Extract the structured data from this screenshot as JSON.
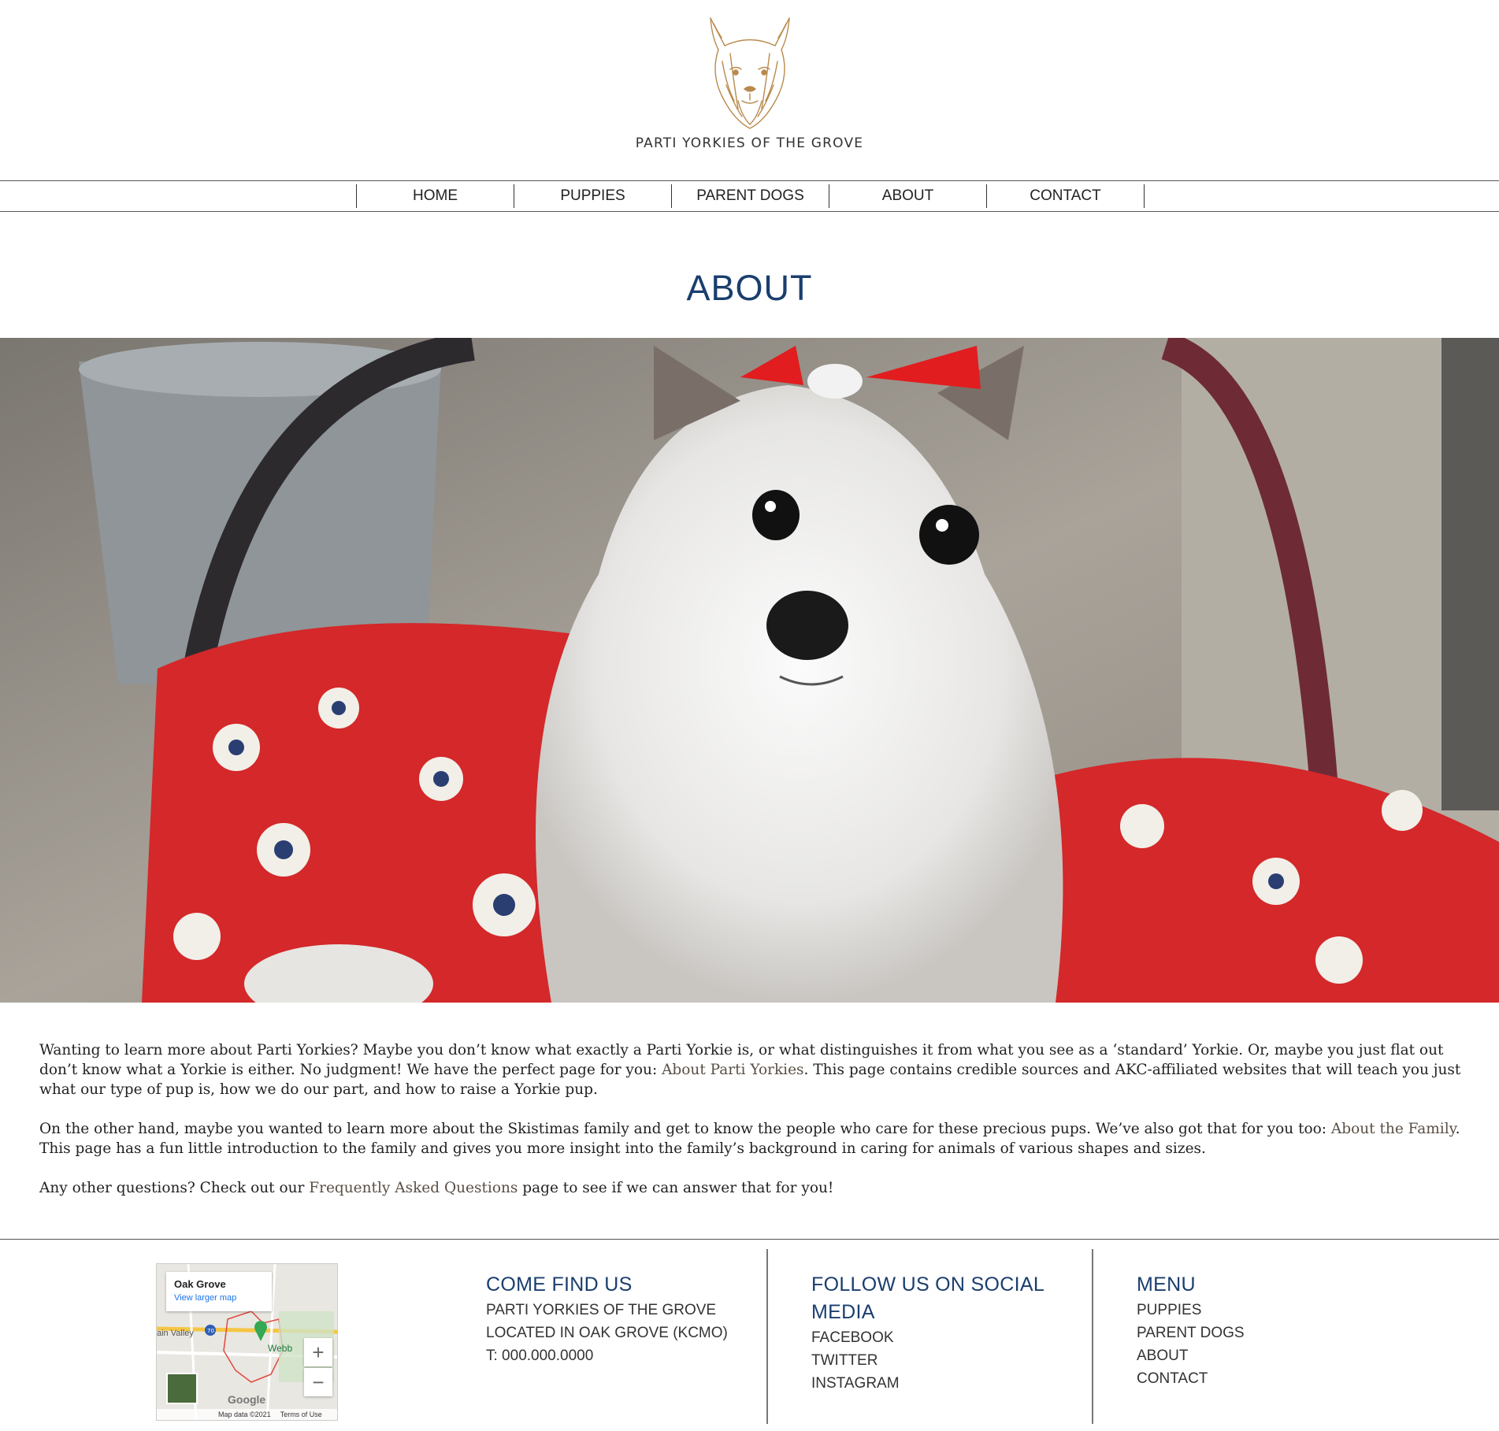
{
  "header": {
    "brand": "PARTI YORKIES OF THE GROVE",
    "logo_icon": "yorkie-sketch-logo",
    "logo_color": "#b98a4e"
  },
  "nav": {
    "items": [
      {
        "label": "HOME"
      },
      {
        "label": "PUPPIES"
      },
      {
        "label": "PARENT DOGS"
      },
      {
        "label": "ABOUT"
      },
      {
        "label": "CONTACT"
      }
    ]
  },
  "page": {
    "title": "ABOUT",
    "title_color": "#1a3e6e"
  },
  "content": {
    "p1_a": "Wanting to learn more about Parti Yorkies? Maybe you don’t know what exactly a Parti Yorkie is, or what distinguishes it from what you see as a ‘standard’ Yorkie. Or, maybe you just flat out don’t know what a Yorkie is either. No judgment! We have the perfect page for you: ",
    "p1_link": "About Parti Yorkies",
    "p1_b": ". This page contains credible sources and AKC-affiliated websites that will teach you just what our type of pup is, how we do our part, and how to raise a Yorkie pup.",
    "p2_a": "On the other hand, maybe you wanted to learn more about the Skistimas family and get to know the people who care for these precious pups. We’ve also got that for you too: ",
    "p2_link": "About the Family",
    "p2_b": ". This page has a fun little introduction to the family and gives you more insight into the family’s background in caring for animals of various shapes and sizes.",
    "p3_a": "Any other questions? Check out our ",
    "p3_link": "Frequently Asked Questions",
    "p3_b": " page to see if we can answer that for you!"
  },
  "map": {
    "place": "Oak Grove",
    "larger_link": "View larger map",
    "zoom_in": "+",
    "zoom_out": "−",
    "google": "Google",
    "data_note": "Map data ©2021",
    "terms": "Terms of Use",
    "label_valley": "ain Valley",
    "label_webb": "Webb",
    "highway": "70"
  },
  "footer": {
    "find": {
      "heading": "COME FIND US",
      "lines": [
        "PARTI YORKIES OF THE GROVE",
        "LOCATED IN OAK GROVE (KCMO)",
        "T: 000.000.0000"
      ]
    },
    "social": {
      "heading_1": "FOLLOW US ON SOCIAL",
      "heading_2": "MEDIA",
      "links": [
        "FACEBOOK",
        "TWITTER",
        "INSTAGRAM"
      ]
    },
    "menu": {
      "heading": "MENU",
      "links": [
        "PUPPIES",
        "PARENT DOGS",
        "ABOUT",
        "CONTACT"
      ]
    }
  }
}
